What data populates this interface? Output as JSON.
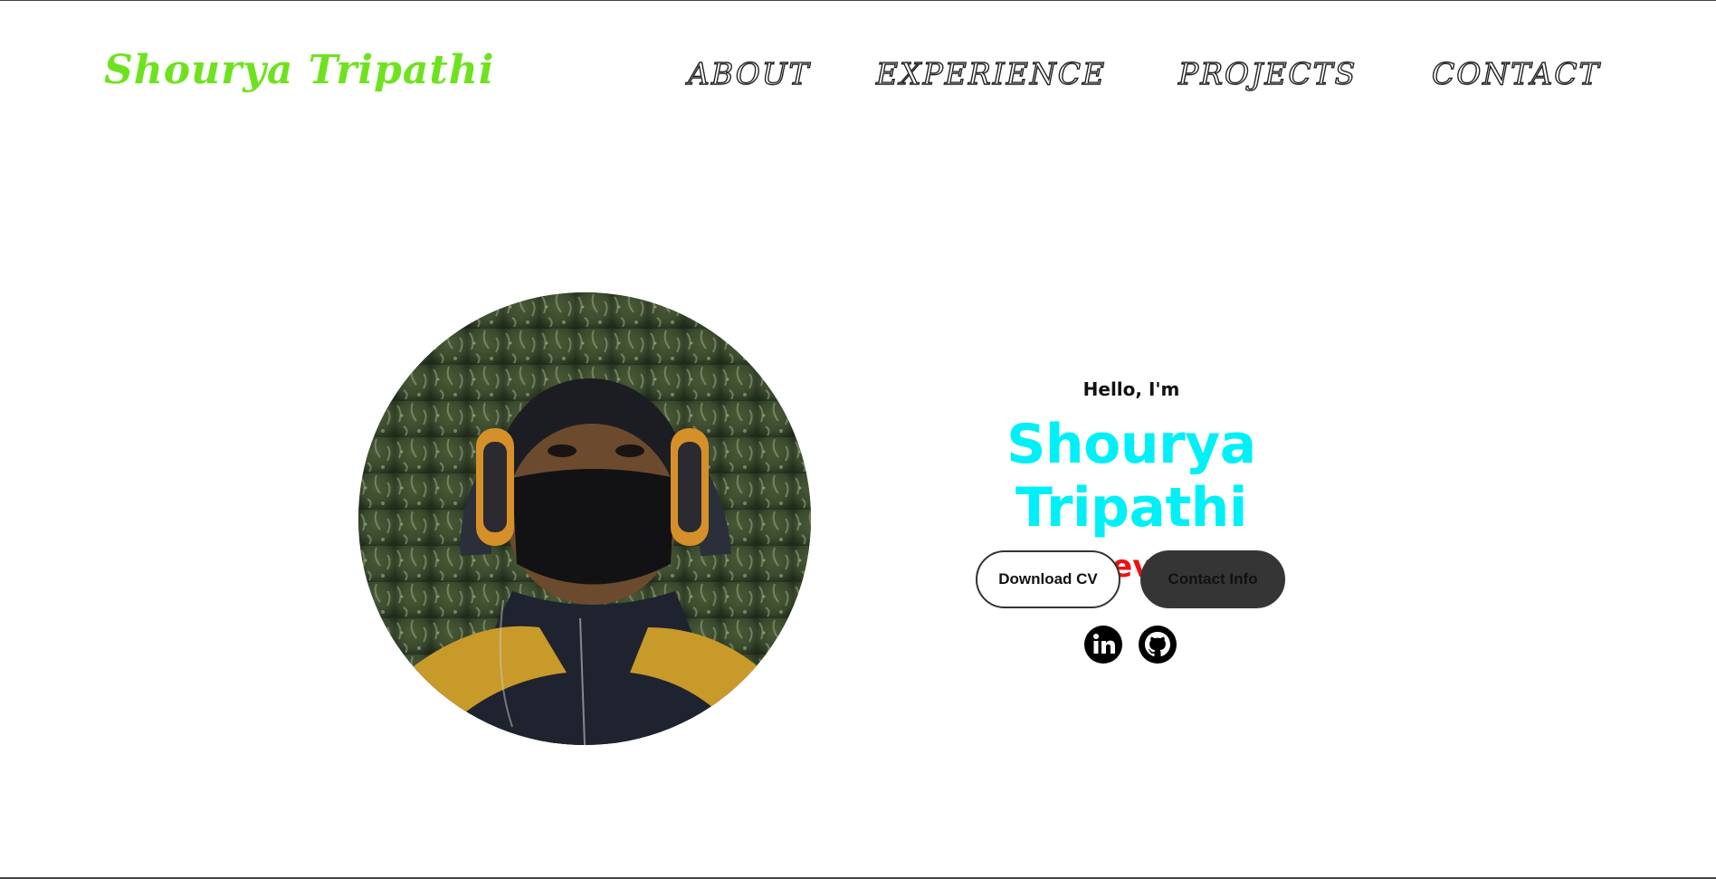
{
  "header": {
    "logo_text": "Shourya Tripathi",
    "logo_color": "#6fe21f",
    "nav": [
      {
        "label": "ABOUT"
      },
      {
        "label": "EXPERIENCE"
      },
      {
        "label": "PROJECTS"
      },
      {
        "label": "CONTACT"
      }
    ]
  },
  "hero": {
    "greeting": "Hello, I'm",
    "name": "Shourya Tripathi",
    "name_color": "#00f0f8",
    "role": "Web Developer",
    "role_color": "#ee1111",
    "buttons": {
      "download_cv": "Download CV",
      "contact_info": "Contact Info"
    },
    "socials": [
      {
        "icon": "linkedin-icon"
      },
      {
        "icon": "github-icon"
      }
    ]
  }
}
